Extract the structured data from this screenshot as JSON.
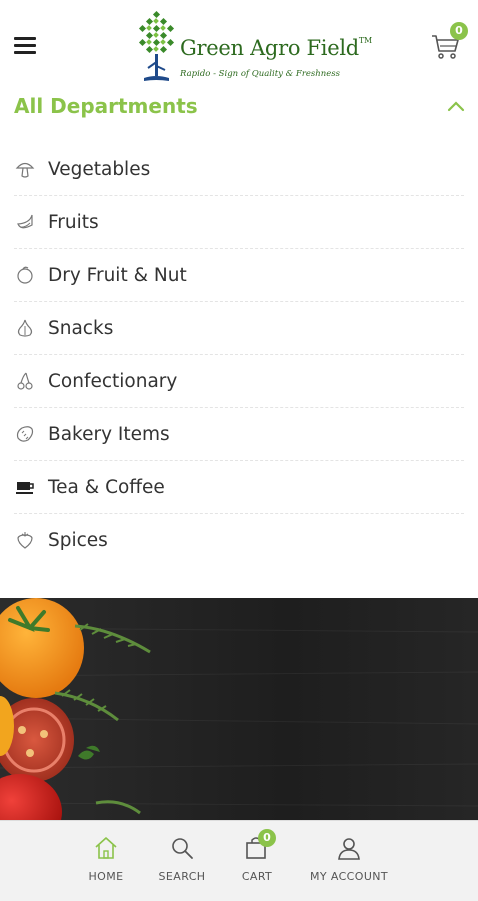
{
  "header": {
    "brand_name": "Green Agro Field",
    "brand_tm": "TM",
    "tagline": "Rapido - Sign of Quality & Freshness",
    "cart_count": "0"
  },
  "departments": {
    "title": "All Departments",
    "items": [
      {
        "label": "Vegetables",
        "icon": "mushroom-icon"
      },
      {
        "label": "Fruits",
        "icon": "banana-icon"
      },
      {
        "label": "Dry Fruit & Nut",
        "icon": "nut-icon"
      },
      {
        "label": "Snacks",
        "icon": "garlic-icon"
      },
      {
        "label": "Confectionary",
        "icon": "cherry-icon"
      },
      {
        "label": "Bakery Items",
        "icon": "bread-icon"
      },
      {
        "label": "Tea & Coffee",
        "icon": "coffee-cup-icon"
      },
      {
        "label": "Spices",
        "icon": "strawberry-icon"
      }
    ]
  },
  "bottom_nav": {
    "home": "HOME",
    "search": "SEARCH",
    "cart": "CART",
    "cart_count": "0",
    "account": "MY ACCOUNT"
  },
  "colors": {
    "accent": "#8bc34a",
    "brand": "#2d6a1f"
  }
}
